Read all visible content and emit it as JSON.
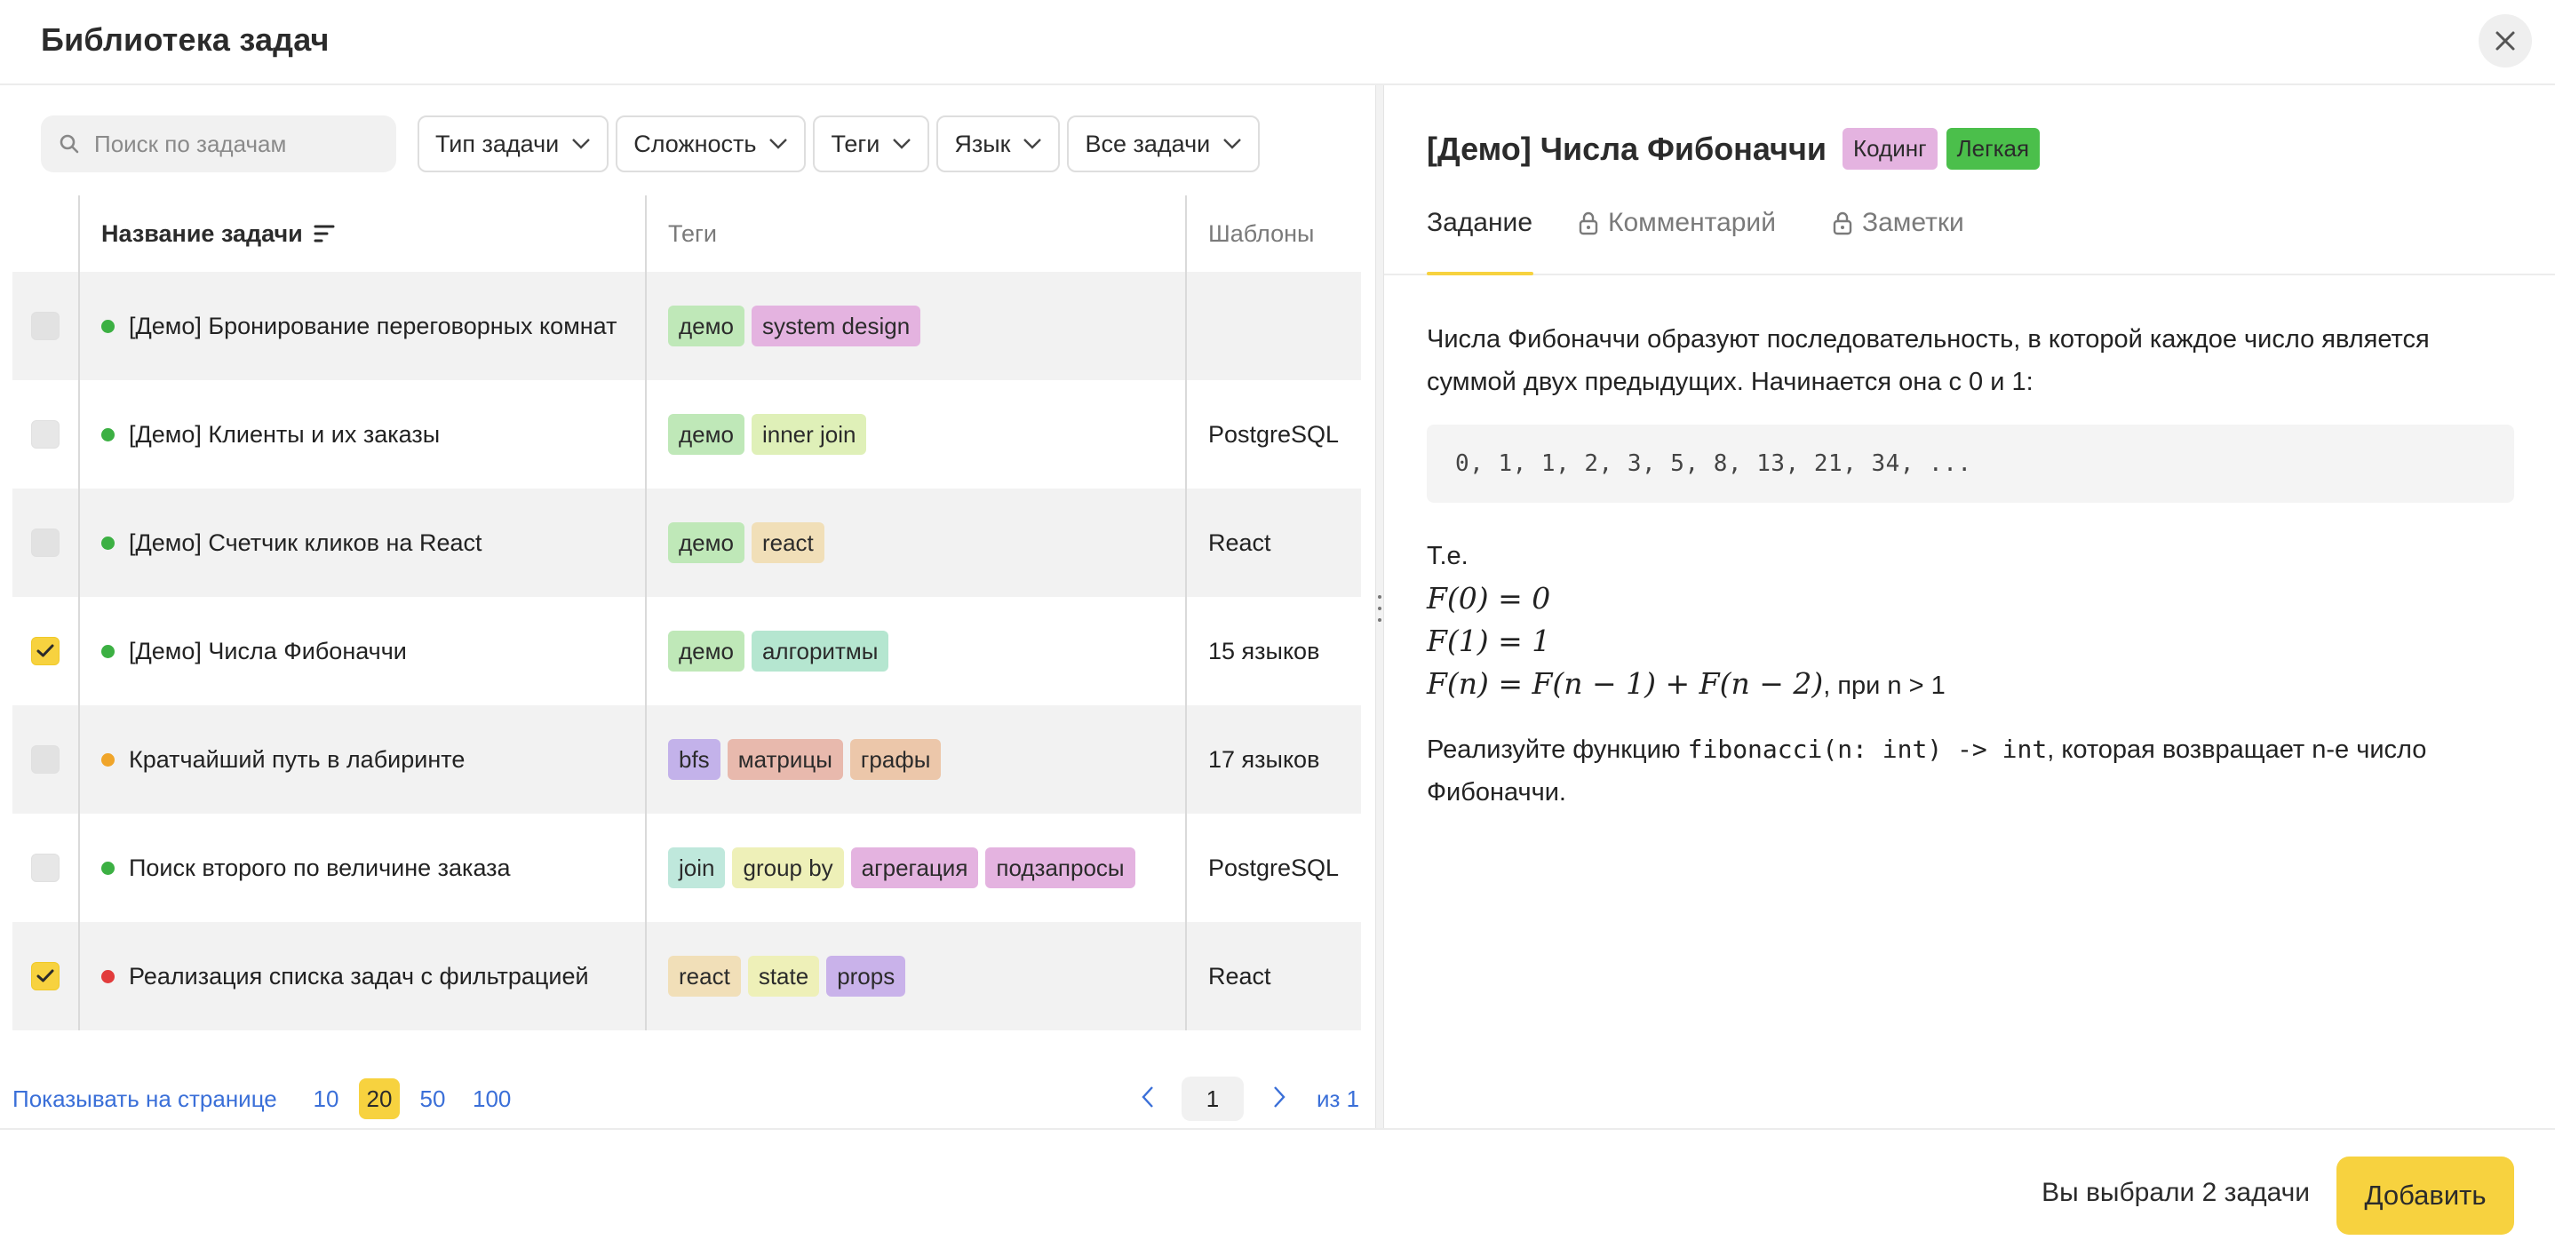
{
  "header": {
    "title": "Библиотека задач"
  },
  "toolbar": {
    "search_placeholder": "Поиск по задачам",
    "filters": [
      "Тип задачи",
      "Сложность",
      "Теги",
      "Язык",
      "Все задачи"
    ]
  },
  "table": {
    "columns": [
      "Название задачи",
      "Теги",
      "Шаблоны"
    ],
    "rows": [
      {
        "checked": false,
        "status": "#3cb043",
        "name": "[Демо] Бронирование переговорных комнат",
        "tags": [
          {
            "label": "демо",
            "color": "#bfe8b8"
          },
          {
            "label": "system design",
            "color": "#e4b3e0"
          }
        ],
        "template": ""
      },
      {
        "checked": false,
        "status": "#3cb043",
        "name": "[Демо] Клиенты и их заказы",
        "tags": [
          {
            "label": "демо",
            "color": "#bfe8b8"
          },
          {
            "label": "inner join",
            "color": "#dff0b8"
          }
        ],
        "template": "PostgreSQL"
      },
      {
        "checked": false,
        "status": "#3cb043",
        "name": "[Демо] Счетчик кликов на React",
        "tags": [
          {
            "label": "демо",
            "color": "#bfe8b8"
          },
          {
            "label": "react",
            "color": "#f1dfb8"
          }
        ],
        "template": "React"
      },
      {
        "checked": true,
        "status": "#3cb043",
        "name": "[Демо] Числа Фибоначчи",
        "tags": [
          {
            "label": "демо",
            "color": "#bfe8b8"
          },
          {
            "label": "алгоритмы",
            "color": "#b5e6d0"
          }
        ],
        "template": "15 языков"
      },
      {
        "checked": false,
        "status": "#f0a52a",
        "name": "Кратчайший путь в лабиринте",
        "tags": [
          {
            "label": "bfs",
            "color": "#c3b2ea"
          },
          {
            "label": "матрицы",
            "color": "#e8b9ad"
          },
          {
            "label": "графы",
            "color": "#ecc7aa"
          }
        ],
        "template": "17 языков"
      },
      {
        "checked": false,
        "status": "#3cb043",
        "name": "Поиск второго по величине заказа",
        "tags": [
          {
            "label": "join",
            "color": "#bfe8dc"
          },
          {
            "label": "group by",
            "color": "#eef0b8"
          },
          {
            "label": "агрегация",
            "color": "#e4b3e0"
          },
          {
            "label": "подзапросы",
            "color": "#e4b3e0"
          }
        ],
        "template": "PostgreSQL"
      },
      {
        "checked": true,
        "status": "#e23c3c",
        "name": "Реализация списка задач с фильтрацией",
        "tags": [
          {
            "label": "react",
            "color": "#f1dfb8"
          },
          {
            "label": "state",
            "color": "#eef0b8"
          },
          {
            "label": "props",
            "color": "#c9b2ea"
          }
        ],
        "template": "React"
      }
    ]
  },
  "pagination": {
    "per_page_label": "Показывать на странице",
    "per_page_options": [
      "10",
      "20",
      "50",
      "100"
    ],
    "per_page_selected": "20",
    "current_page": "1",
    "of_label": "из 1"
  },
  "task": {
    "title": "[Демо] Числа Фибоначчи",
    "badges": [
      {
        "label": "Кодинг",
        "color": "#e4b3e0"
      },
      {
        "label": "Легкая",
        "color": "#4bbf4b"
      }
    ],
    "tabs": [
      "Задание",
      "Комментарий",
      "Заметки"
    ],
    "intro": "Числа Фибоначчи образуют последовательность, в которой каждое число является суммой двух предыдущих. Начинается она с 0 и 1:",
    "sequence": "0, 1, 1, 2, 3, 5, 8, 13, 21, 34, ...",
    "te": "Т.е.",
    "f0": "F(0) = 0",
    "f1": "F(1) = 1",
    "fn": "F(n) = F(n − 1) + F(n − 2)",
    "fn_suffix": ", при n > 1",
    "impl_prefix": "Реализуйте функцию ",
    "impl_code": "fibonacci(n: int) -> int",
    "impl_suffix": ", которая возвращает n-е число Фибоначчи."
  },
  "footer": {
    "selected_text": "Вы выбрали 2 задачи",
    "add_label": "Добавить"
  },
  "colors": {
    "accent": "#f7d23f",
    "link": "#3a6fd8"
  }
}
